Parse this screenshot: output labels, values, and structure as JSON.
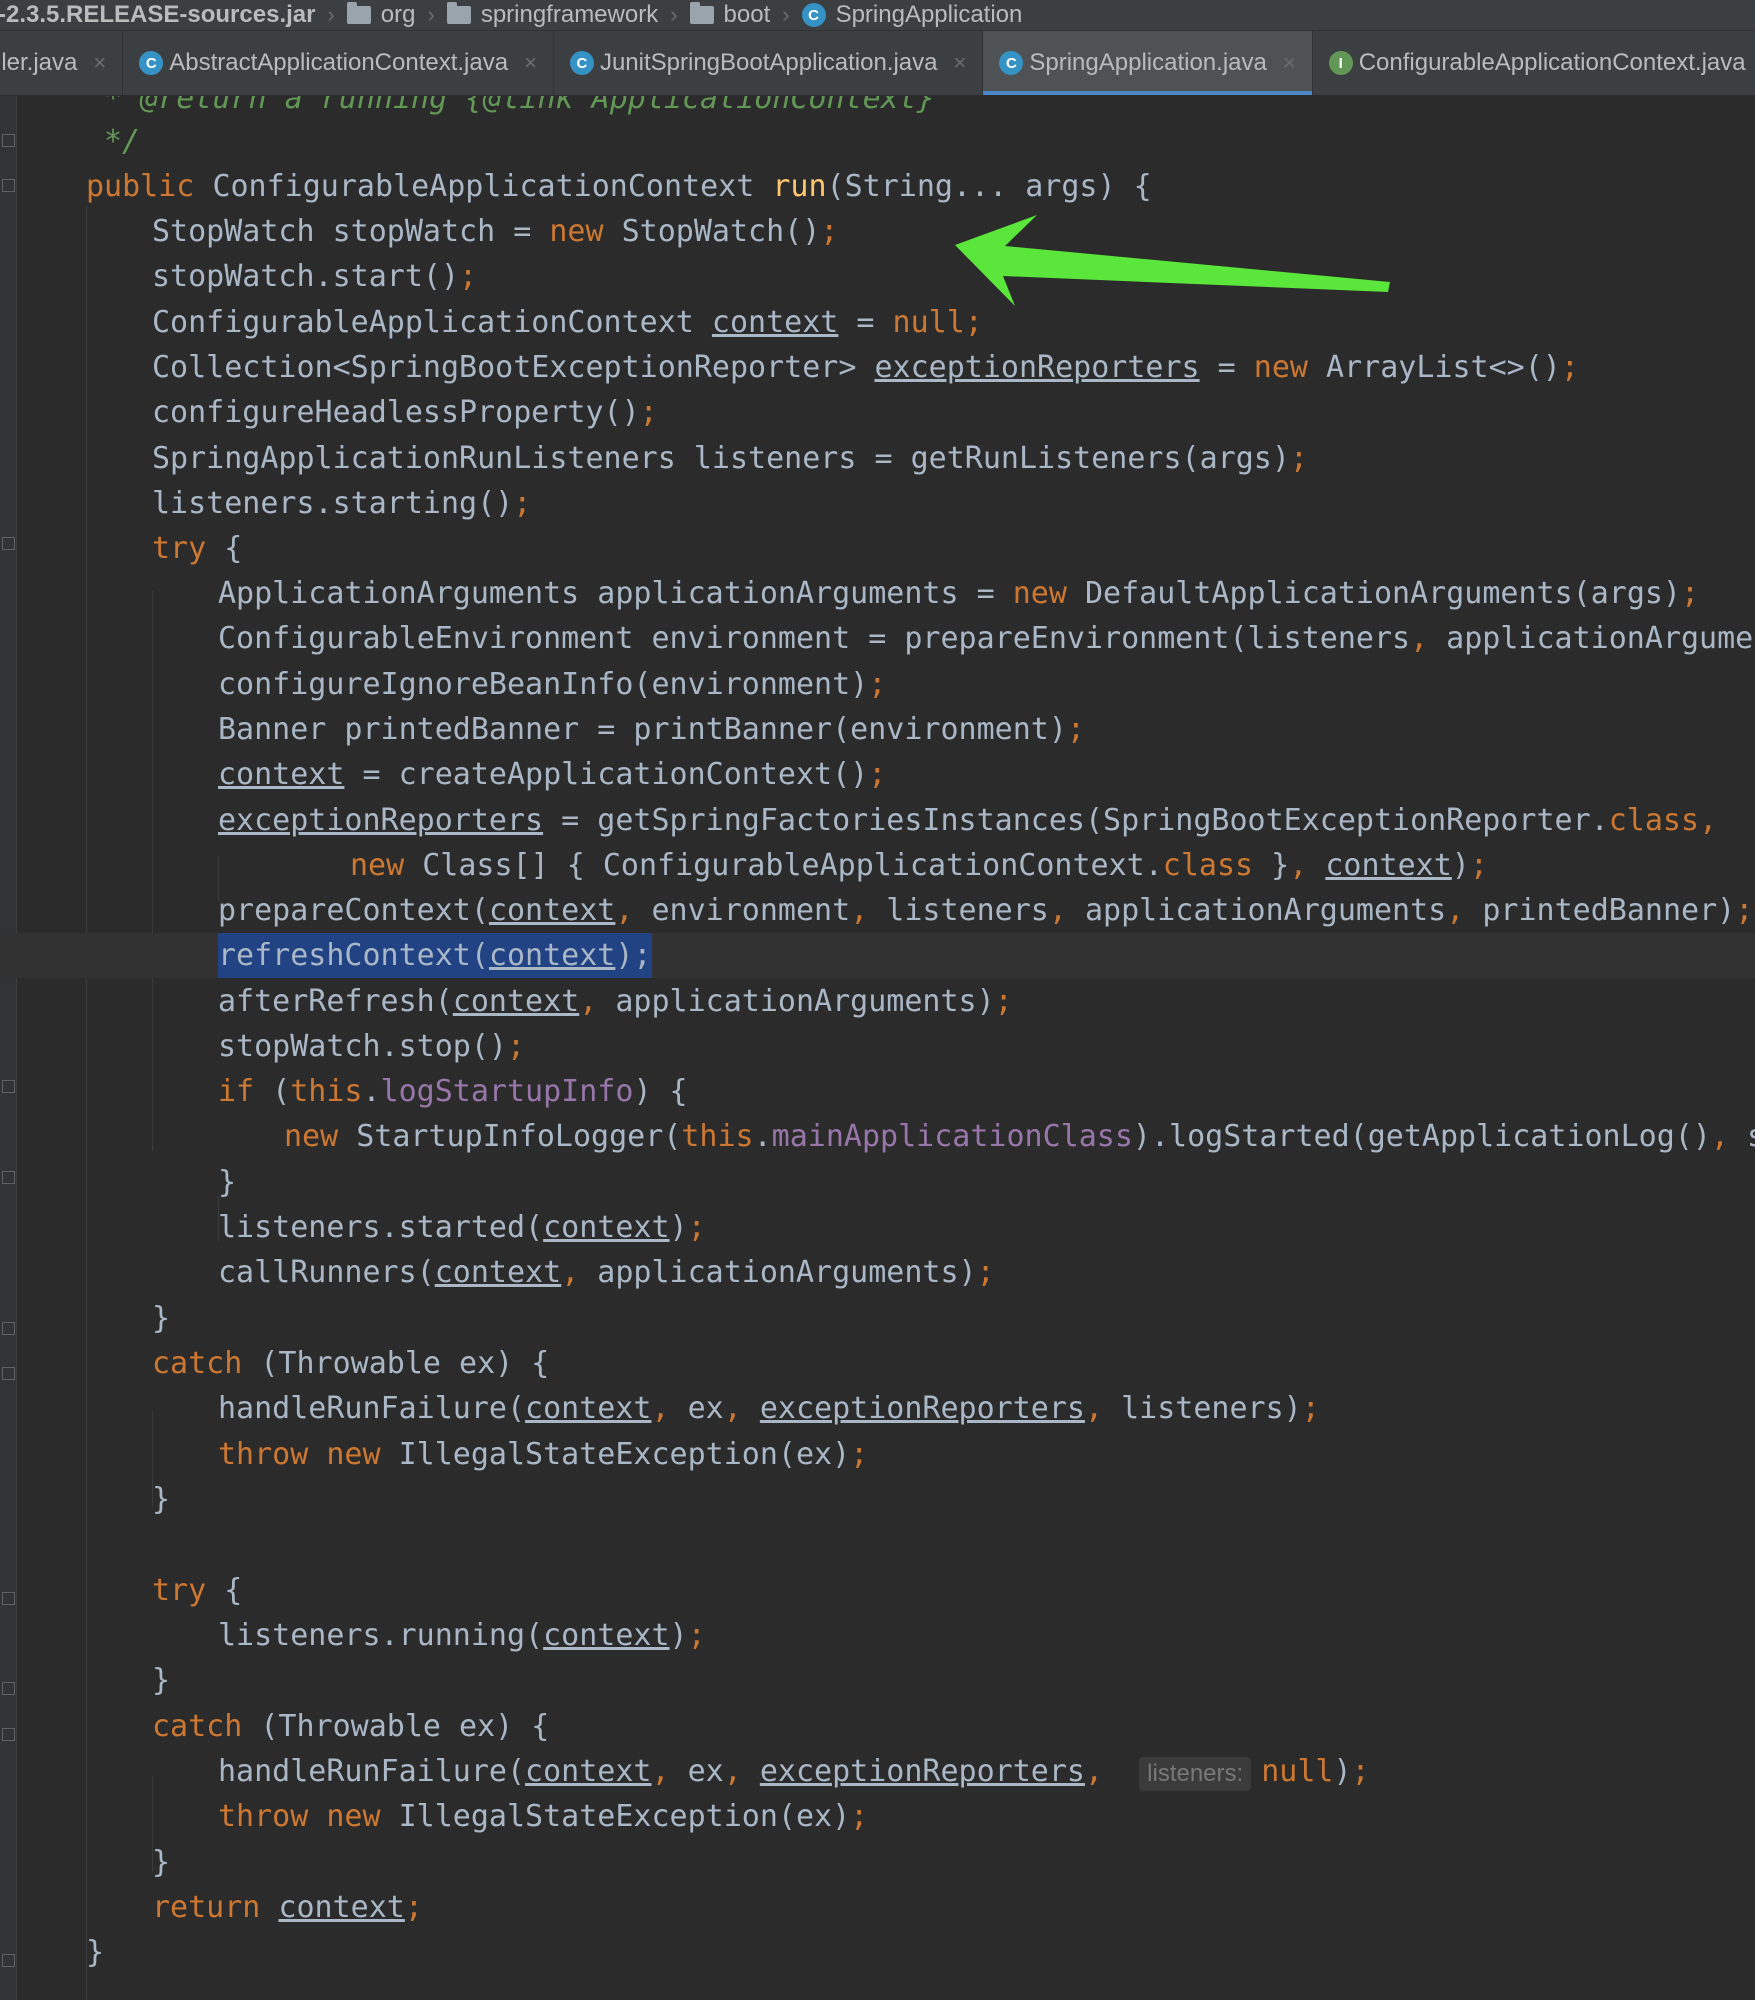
{
  "breadcrumb": [
    {
      "label": "-2.3.5.RELEASE-sources.jar",
      "icon": "none"
    },
    {
      "label": "org",
      "icon": "folder-icon"
    },
    {
      "label": "springframework",
      "icon": "folder-icon"
    },
    {
      "label": "boot",
      "icon": "folder-icon"
    },
    {
      "label": "SpringApplication",
      "icon": "class-icon"
    }
  ],
  "tabs": [
    {
      "label": "ller.java",
      "icon": "none",
      "active": false
    },
    {
      "label": "AbstractApplicationContext.java",
      "icon": "class-icon",
      "active": false
    },
    {
      "label": "JunitSpringBootApplication.java",
      "icon": "class-icon",
      "active": false
    },
    {
      "label": "SpringApplication.java",
      "icon": "class-icon",
      "active": true
    },
    {
      "label": "ConfigurableApplicationContext.java",
      "icon": "interface-icon",
      "active": false
    }
  ],
  "tab_close_glyph": "×",
  "hint": {
    "label": "listeners:"
  },
  "accent_colors": {
    "keyword": "#cc7832",
    "field": "#9876aa",
    "comment": "#629755",
    "method_decl": "#ffc66d",
    "selection": "#214283",
    "arrow": "#5ae63a"
  },
  "code": {
    "comment_partial": "* @return a running {@link ApplicationContext}",
    "comment_end": "*/",
    "kw_public": "public",
    "kw_new": "new",
    "kw_try": "try",
    "kw_catch": "catch",
    "kw_throw": "throw",
    "kw_if": "if",
    "kw_this": "this",
    "kw_null": "null",
    "kw_class": "class",
    "kw_return": "return",
    "method_name": "run",
    "field_log": "logStartupInfo",
    "field_main": "mainApplicationClass",
    "var_context": "context",
    "var_reporters": "exceptionReporters",
    "t_sig_a": "ConfigurableApplicationContext ",
    "t_sig_b": "(String... args) {",
    "t_stopwatch_a": "StopWatch stopWatch = ",
    "t_stopwatch_b": "StopWatch()",
    "t_start": "stopWatch.start()",
    "t_ctx_a": "ConfigurableApplicationContext ",
    "t_ctx_b": " = ",
    "t_coll_a": "Collection<SpringBootExceptionReporter> ",
    "t_coll_b": " = ",
    "t_coll_c": " ArrayList<>()",
    "t_headless": "configureHeadlessProperty()",
    "t_listeners": "SpringApplicationRunListeners listeners = getRunListeners(args)",
    "t_starting": "listeners.starting()",
    "t_brace_open": " {",
    "t_appargs_a": "ApplicationArguments applicationArguments = ",
    "t_appargs_b": " DefaultApplicationArguments(args)",
    "t_env": "ConfigurableEnvironment environment = prepareEnvironment(listeners",
    "t_env_b": " applicationArguments)",
    "t_ignore": "configureIgnoreBeanInfo(environment)",
    "t_banner": "Banner printedBanner = printBanner(environment)",
    "t_create": " = createApplicationContext()",
    "t_factories": " = getSpringFactoriesInstances(SpringBootExceptionReporter.",
    "t_classarr_a": " Class[] { ConfigurableApplicationContext.",
    "t_classarr_b": " }",
    "t_prepare_a": "prepareContext(",
    "t_prepare_b": " environment",
    "t_prepare_c": " listeners",
    "t_prepare_d": " applicationArguments",
    "t_prepare_e": " printedBanner)",
    "t_refresh_a": "refreshContext(",
    "t_refresh_b": ");",
    "t_after_a": "afterRefresh(",
    "t_after_b": " applicationArguments)",
    "t_stop": "stopWatch.stop()",
    "t_if_a": " (",
    "t_if_b": ") {",
    "t_logger_a": " StartupInfoLogger(",
    "t_logger_b": ").logStarted(getApplicationLog()",
    "t_logger_c": " stopWatc",
    "t_close": "}",
    "t_started": "listeners.started(",
    "t_runners": "callRunners(",
    "t_runners_b": " applicationArguments)",
    "t_catch_sig": " (Throwable ex) {",
    "t_fail_a": "handleRunFailure(",
    "t_fail_b": " ex",
    "t_fail_c": " listeners)",
    "t_illegal": " IllegalStateException(ex)",
    "t_running": "listeners.running(",
    "t_paren_close": ")",
    "semi": ";",
    "comma": ","
  }
}
